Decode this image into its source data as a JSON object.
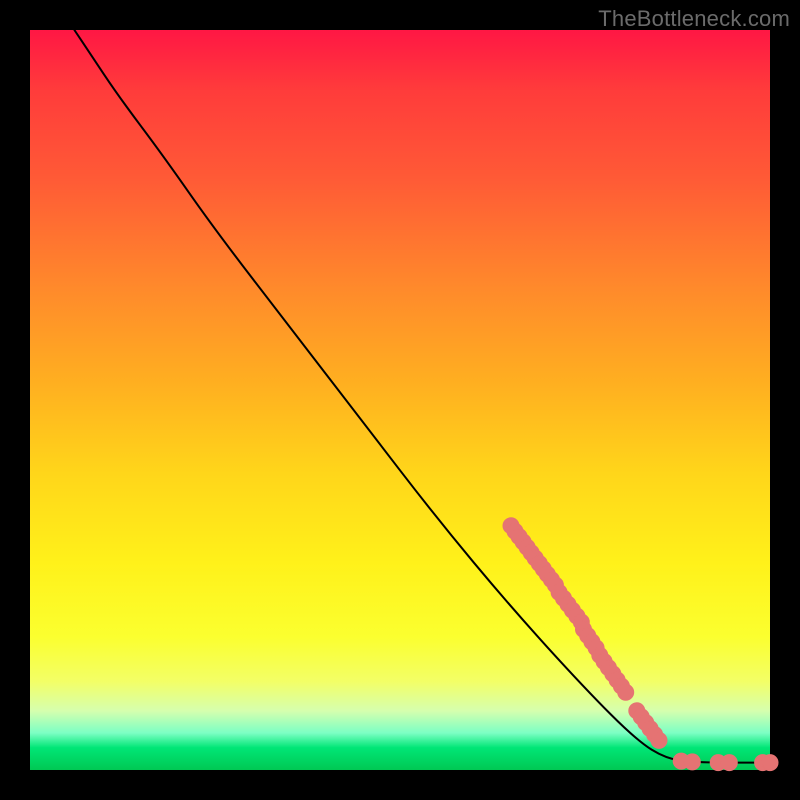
{
  "attribution": "TheBottleneck.com",
  "colors": {
    "dot": "#e57373",
    "curve": "#000000",
    "frame": "#000000"
  },
  "chart_data": {
    "type": "line",
    "title": "",
    "xlabel": "",
    "ylabel": "",
    "xlim": [
      0,
      100
    ],
    "ylim": [
      0,
      100
    ],
    "grid": false,
    "legend": false,
    "curve": [
      {
        "x": 6,
        "y": 100
      },
      {
        "x": 8,
        "y": 97
      },
      {
        "x": 12,
        "y": 91
      },
      {
        "x": 18,
        "y": 83
      },
      {
        "x": 25,
        "y": 73
      },
      {
        "x": 35,
        "y": 60
      },
      {
        "x": 45,
        "y": 47
      },
      {
        "x": 55,
        "y": 34
      },
      {
        "x": 65,
        "y": 22
      },
      {
        "x": 75,
        "y": 11
      },
      {
        "x": 82,
        "y": 4
      },
      {
        "x": 86,
        "y": 1.5
      },
      {
        "x": 90,
        "y": 1
      },
      {
        "x": 100,
        "y": 1
      }
    ],
    "highlight_segments": [
      {
        "x1": 65,
        "y1": 33,
        "x2": 71,
        "y2": 25
      },
      {
        "x1": 71.5,
        "y1": 24,
        "x2": 74.5,
        "y2": 20
      },
      {
        "x1": 74.8,
        "y1": 19,
        "x2": 76.5,
        "y2": 16.5
      },
      {
        "x1": 77,
        "y1": 15.5,
        "x2": 80.5,
        "y2": 10.5
      },
      {
        "x1": 82,
        "y1": 8,
        "x2": 85,
        "y2": 4
      }
    ],
    "highlight_dots_flat": [
      {
        "x": 88,
        "y": 1.2
      },
      {
        "x": 89.5,
        "y": 1.1
      },
      {
        "x": 93,
        "y": 1.0
      },
      {
        "x": 94.5,
        "y": 1.0
      },
      {
        "x": 99,
        "y": 1.0
      },
      {
        "x": 100,
        "y": 1.0
      }
    ]
  }
}
